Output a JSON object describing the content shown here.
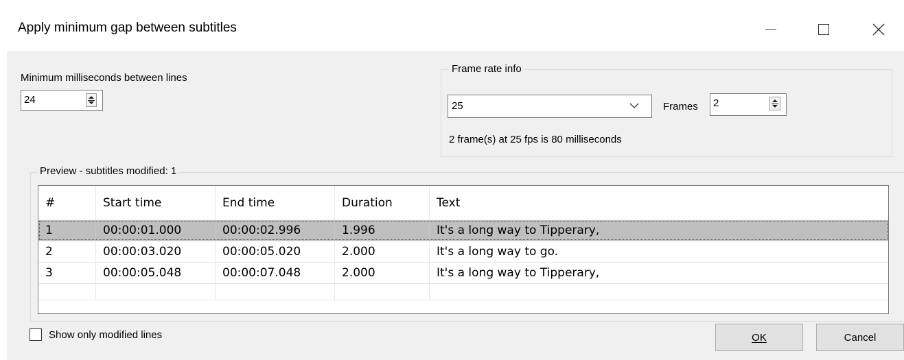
{
  "window": {
    "title": "Apply minimum gap between subtitles",
    "controls": {
      "minimize_icon": "minimize-icon",
      "maximize_icon": "maximize-icon",
      "close_icon": "close-icon"
    }
  },
  "min_gap": {
    "label": "Minimum milliseconds between lines",
    "value": "24"
  },
  "frame_rate": {
    "group_label": "Frame rate info",
    "fps_value": "25",
    "frames_label": "Frames",
    "frames_value": "2",
    "info_text": "2 frame(s) at 25 fps is 80 milliseconds"
  },
  "preview": {
    "group_label": "Preview - subtitles modified: 1",
    "columns": [
      "#",
      "Start time",
      "End time",
      "Duration",
      "Text"
    ],
    "rows": [
      {
        "num": "1",
        "start": "00:00:01.000",
        "end": "00:00:02.996",
        "duration": "1.996",
        "text": "It's a long way to Tipperary,"
      },
      {
        "num": "2",
        "start": "00:00:03.020",
        "end": "00:00:05.020",
        "duration": "2.000",
        "text": "It's a long way to go."
      },
      {
        "num": "3",
        "start": "00:00:05.048",
        "end": "00:00:07.048",
        "duration": "2.000",
        "text": "It's a long way to Tipperary,"
      }
    ]
  },
  "show_only_modified": {
    "label": "Show only modified lines",
    "checked": false
  },
  "buttons": {
    "ok": "OK",
    "cancel": "Cancel"
  },
  "colors": {
    "selected_row": "#bfbfbf",
    "window_bg": "#f0f0f0"
  }
}
